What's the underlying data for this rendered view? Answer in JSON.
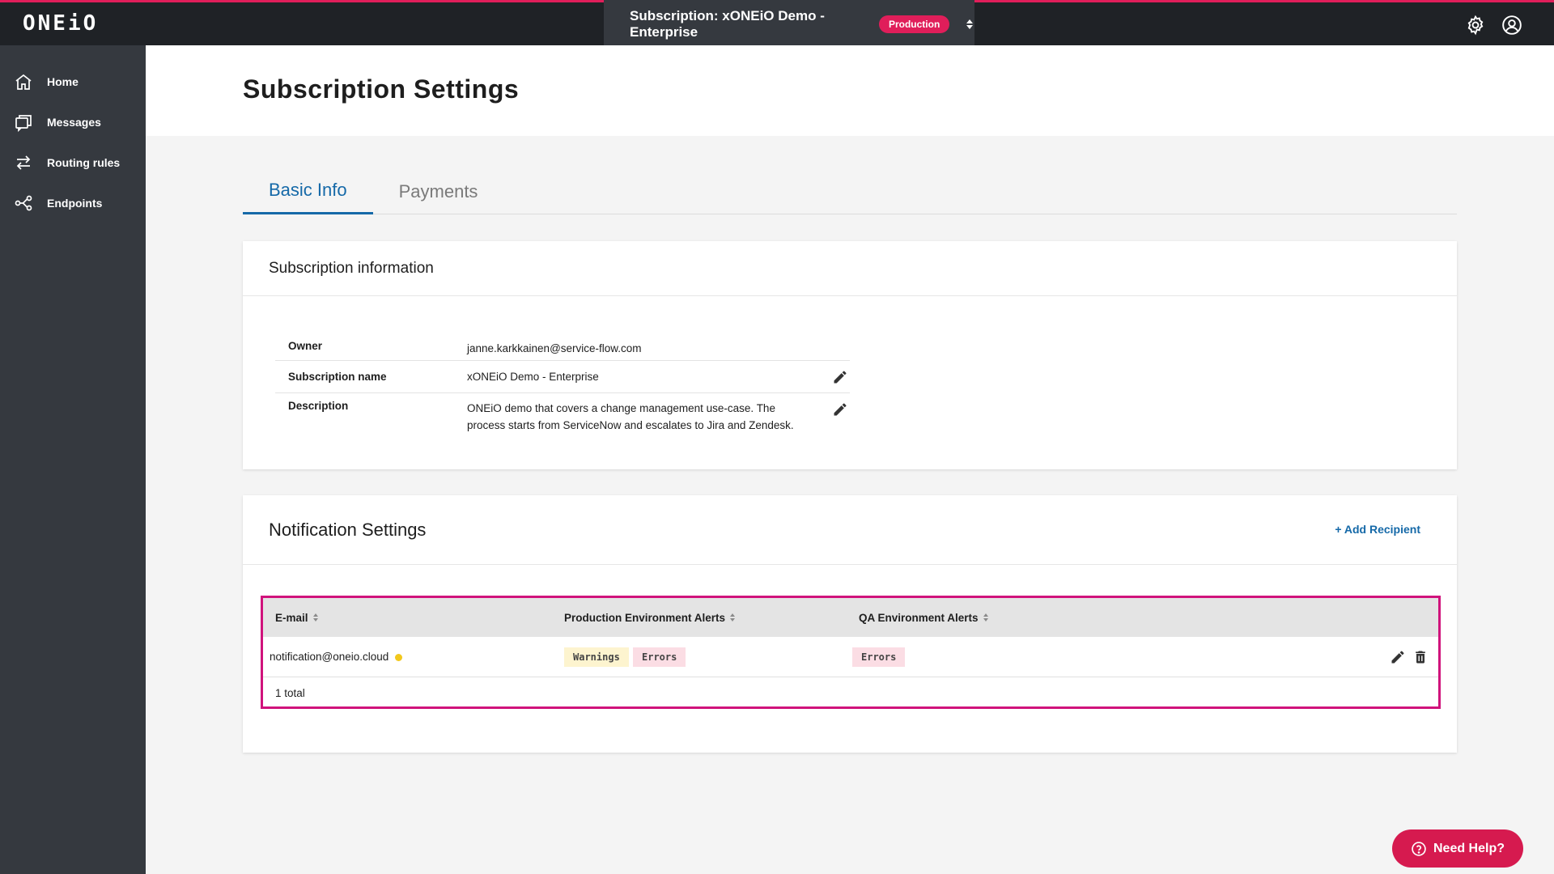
{
  "app": {
    "logo": "ONEiO"
  },
  "topbar": {
    "subscription_label": "Subscription: xONEiO Demo - Enterprise",
    "environment_badge": "Production"
  },
  "sidebar": {
    "items": [
      {
        "label": "Home",
        "icon": "home-icon"
      },
      {
        "label": "Messages",
        "icon": "messages-icon"
      },
      {
        "label": "Routing rules",
        "icon": "routing-icon"
      },
      {
        "label": "Endpoints",
        "icon": "endpoints-icon"
      }
    ]
  },
  "page": {
    "title": "Subscription Settings"
  },
  "tabs": [
    {
      "label": "Basic Info",
      "active": true
    },
    {
      "label": "Payments",
      "active": false
    }
  ],
  "subscription_info": {
    "heading": "Subscription information",
    "rows": [
      {
        "label": "Owner",
        "value": "janne.karkkainen@service-flow.com",
        "editable": false
      },
      {
        "label": "Subscription name",
        "value": "xONEiO Demo - Enterprise",
        "editable": true
      },
      {
        "label": "Description",
        "value": "ONEiO demo that covers a change management use-case. The process starts from ServiceNow and escalates to Jira and Zendesk.",
        "editable": true
      }
    ]
  },
  "notification_settings": {
    "heading": "Notification Settings",
    "add_recipient": "+ Add Recipient",
    "columns": [
      "E-mail",
      "Production Environment Alerts",
      "QA Environment Alerts"
    ],
    "rows": [
      {
        "email": "notification@oneio.cloud",
        "production_alerts": [
          "Warnings",
          "Errors"
        ],
        "qa_alerts": [
          "Errors"
        ]
      }
    ],
    "total": "1 total"
  },
  "help": {
    "label": "Need Help?"
  },
  "colors": {
    "brand_accent": "#e01e5a",
    "link_blue": "#1569a8",
    "highlight_border": "#d0137c",
    "warnings_tag": "#fdf4cf",
    "errors_tag": "#fbdde4",
    "status_dot": "#f2c81c"
  }
}
